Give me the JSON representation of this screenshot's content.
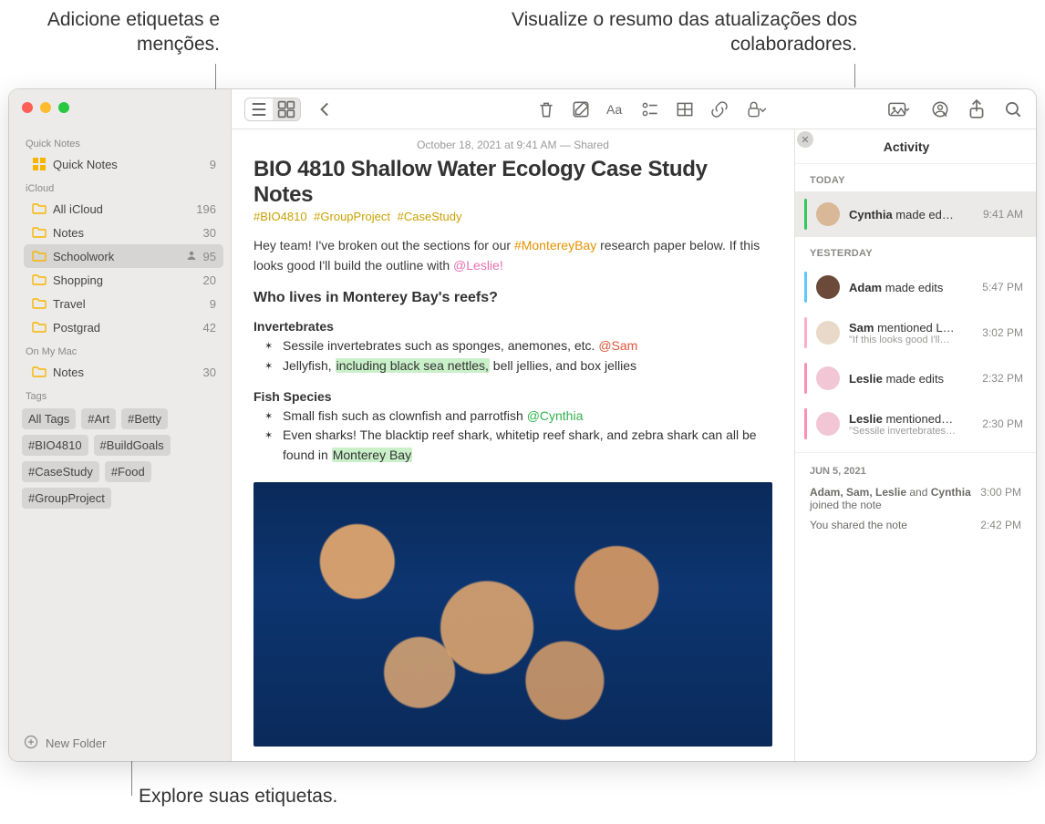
{
  "callouts": {
    "top_left": "Adicione etiquetas e menções.",
    "top_right": "Visualize o resumo das atualizações dos colaboradores.",
    "bottom": "Explore suas etiquetas."
  },
  "sidebar": {
    "sections": [
      {
        "head": "Quick Notes",
        "items": [
          {
            "icon": "qn",
            "label": "Quick Notes",
            "count": "9"
          }
        ]
      },
      {
        "head": "iCloud",
        "items": [
          {
            "icon": "folder",
            "label": "All iCloud",
            "count": "196"
          },
          {
            "icon": "folder",
            "label": "Notes",
            "count": "30"
          },
          {
            "icon": "folder",
            "label": "Schoolwork",
            "count": "95",
            "selected": true,
            "shared": true
          },
          {
            "icon": "folder",
            "label": "Shopping",
            "count": "20"
          },
          {
            "icon": "folder",
            "label": "Travel",
            "count": "9"
          },
          {
            "icon": "folder",
            "label": "Postgrad",
            "count": "42"
          }
        ]
      },
      {
        "head": "On My Mac",
        "items": [
          {
            "icon": "folder",
            "label": "Notes",
            "count": "30"
          }
        ]
      }
    ],
    "tags_head": "Tags",
    "tags": [
      "All Tags",
      "#Art",
      "#Betty",
      "#BIO4810",
      "#BuildGoals",
      "#CaseStudy",
      "#Food",
      "#GroupProject"
    ],
    "new_folder": "New Folder"
  },
  "note": {
    "meta": "October 18, 2021 at 9:41 AM — Shared",
    "title": "BIO 4810 Shallow Water Ecology Case Study Notes",
    "tags": [
      "#BIO4810",
      "#GroupProject",
      "#CaseStudy"
    ],
    "para1_a": "Hey team! I've broken out the sections for our ",
    "para1_tag": "#MontereyBay",
    "para1_b": " research paper below. If this looks good I'll build the outline with ",
    "para1_mention": "@Leslie!",
    "h2": "Who lives in Monterey Bay's reefs?",
    "h3a": "Invertebrates",
    "b1a": "Sessile invertebrates such as sponges, anemones, etc. ",
    "b1a_m": "@Sam",
    "b1b_a": "Jellyfish, ",
    "b1b_hl": "including black sea nettles,",
    "b1b_b": " bell jellies, and box jellies",
    "h3b": "Fish Species",
    "b2a_a": "Small fish such as clownfish and parrotfish ",
    "b2a_m": "@Cynthia",
    "b2b_a": "Even sharks! The blacktip reef shark, whitetip reef shark, and zebra shark can all be found in ",
    "b2b_hl": "Monterey Bay"
  },
  "activity": {
    "title": "Activity",
    "groups": [
      {
        "head": "TODAY",
        "items": [
          {
            "color": "#34c759",
            "avatar": "#d8b896",
            "main_b": "Cynthia",
            "main_t": " made ed…",
            "time": "9:41 AM",
            "selected": true
          }
        ]
      },
      {
        "head": "YESTERDAY",
        "items": [
          {
            "color": "#5fc9f8",
            "avatar": "#6b4a3a",
            "main_b": "Adam",
            "main_t": " made edits",
            "time": "5:47 PM"
          },
          {
            "color": "#ffb0c8",
            "avatar": "#e8d9c8",
            "main_b": "Sam",
            "main_t": " mentioned L…",
            "sub": "\"If this looks good I'll…",
            "time": "3:02 PM"
          },
          {
            "color": "#ff8fb3",
            "avatar": "#f3c6d6",
            "main_b": "Leslie",
            "main_t": " made edits",
            "time": "2:32 PM"
          },
          {
            "color": "#ff8fb3",
            "avatar": "#f3c6d6",
            "main_b": "Leslie",
            "main_t": " mentioned…",
            "sub": "\"Sessile invertebrates…",
            "time": "2:30 PM"
          }
        ]
      }
    ],
    "older_head": "JUN 5, 2021",
    "older": [
      {
        "text_b": "Adam, Sam, Leslie",
        "text_m": " and ",
        "text_b2": "Cynthia",
        "text_t": " joined the note",
        "time": "3:00 PM"
      },
      {
        "text": "You shared the note",
        "time": "2:42 PM"
      }
    ]
  }
}
